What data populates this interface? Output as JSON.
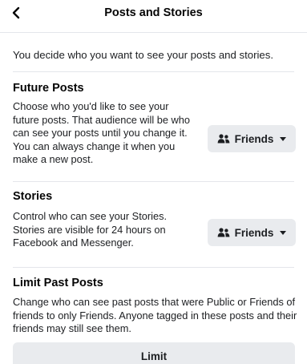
{
  "header": {
    "title": "Posts and Stories",
    "back_icon": "chevron-left-icon"
  },
  "intro": "You decide who you want to see your posts and stories.",
  "future_posts": {
    "title": "Future Posts",
    "description": "Choose who you'd like to see your future posts. That audience will be who can see your posts until you change it. You can always change it when you make a new post.",
    "audience": {
      "icon": "friends-icon",
      "label": "Friends",
      "caret": "caret-down-icon"
    }
  },
  "stories": {
    "title": "Stories",
    "description": "Control who can see your Stories. Stories are visible for 24 hours on Facebook and Messenger.",
    "audience": {
      "icon": "friends-icon",
      "label": "Friends",
      "caret": "caret-down-icon"
    }
  },
  "limit_past_posts": {
    "title": "Limit Past Posts",
    "description": "Change who can see past posts that were Public or Friends of friends to only Friends. Anyone tagged in these posts and their friends may still see them.",
    "button_label": "Limit"
  }
}
